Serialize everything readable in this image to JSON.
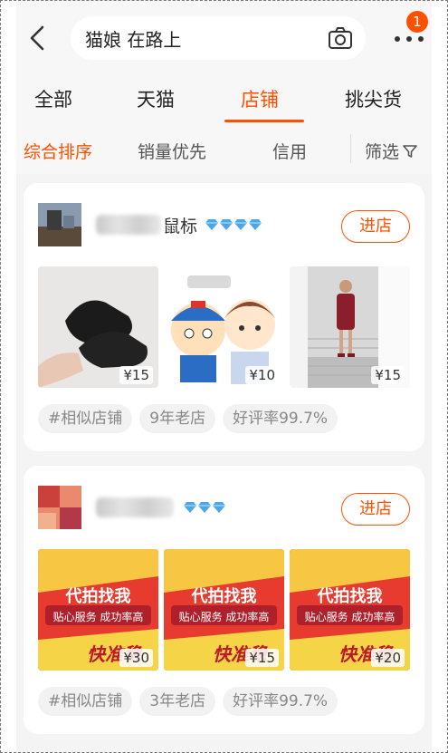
{
  "notification_count": "1",
  "search": {
    "query": "猫娘 在路上"
  },
  "tabs": [
    {
      "label": "全部",
      "active": false
    },
    {
      "label": "天猫",
      "active": false
    },
    {
      "label": "店铺",
      "active": true
    },
    {
      "label": "挑尖货",
      "active": false
    }
  ],
  "sort": [
    {
      "label": "综合排序",
      "active": true
    },
    {
      "label": "销量优先",
      "active": false
    },
    {
      "label": "信用",
      "active": false
    },
    {
      "label": "筛选",
      "active": false
    }
  ],
  "colors": {
    "accent": "#ff5000",
    "diamond": "#4aa8e8"
  },
  "shops": [
    {
      "name_suffix": "鼠标",
      "diamond_count": 4,
      "enter_label": "进店",
      "items": [
        {
          "price": "¥15",
          "image": "black-shoes"
        },
        {
          "price": "¥10",
          "image": "cartoon-boys"
        },
        {
          "price": "¥15",
          "image": "girl-on-stairs"
        }
      ],
      "tags": [
        "#相似店铺",
        "9年老店",
        "好评率99.7%"
      ]
    },
    {
      "name_suffix": "",
      "diamond_count": 3,
      "enter_label": "进店",
      "items": [
        {
          "price": "¥30",
          "image": "promo-poster",
          "headline": "代拍找我",
          "sub": "贴心服务 成功率高",
          "footer": "快准稳"
        },
        {
          "price": "¥15",
          "image": "promo-poster",
          "headline": "代拍找我",
          "sub": "贴心服务 成功率高",
          "footer": "快准稳"
        },
        {
          "price": "¥20",
          "image": "promo-poster",
          "headline": "代拍找我",
          "sub": "贴心服务 成功率高",
          "footer": "快准稳"
        }
      ],
      "tags": [
        "#相似店铺",
        "3年老店",
        "好评率99.7%"
      ]
    }
  ]
}
